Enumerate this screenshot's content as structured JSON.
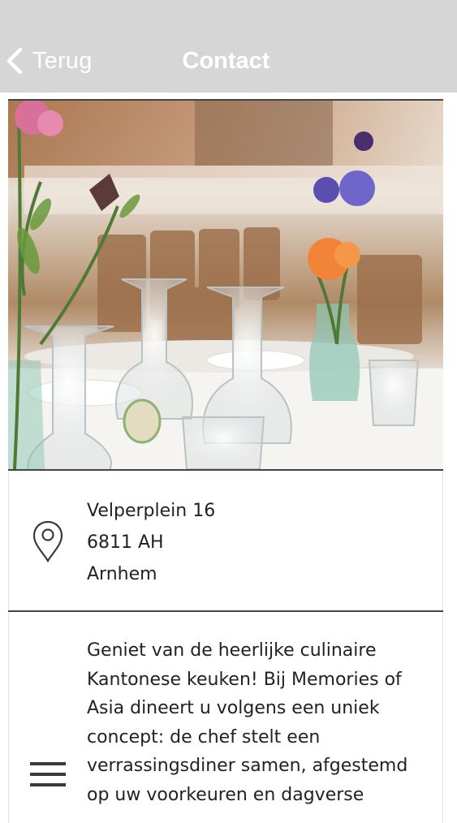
{
  "nav": {
    "back_label": "Terug",
    "title": "Contact"
  },
  "hero": {
    "alt": "Gedekte tafel met wijnglazen en bloemen"
  },
  "address": {
    "street": "Velperplein 16",
    "postcode": "6811 AH",
    "city": "Arnhem"
  },
  "description": {
    "text": "Geniet van de heerlijke culinaire Kantonese keuken! Bij Memories of Asia dineert u volgens een uniek concept: de chef stelt een verrassingsdiner samen, afgestemd op uw voorkeuren en dagverse"
  },
  "colors": {
    "nav_background": "#d6d6d6",
    "nav_text": "#ffffff",
    "divider": "#444444",
    "body_text": "#222222"
  },
  "icons": [
    "chevron-left-icon",
    "map-pin-icon",
    "menu-icon"
  ]
}
